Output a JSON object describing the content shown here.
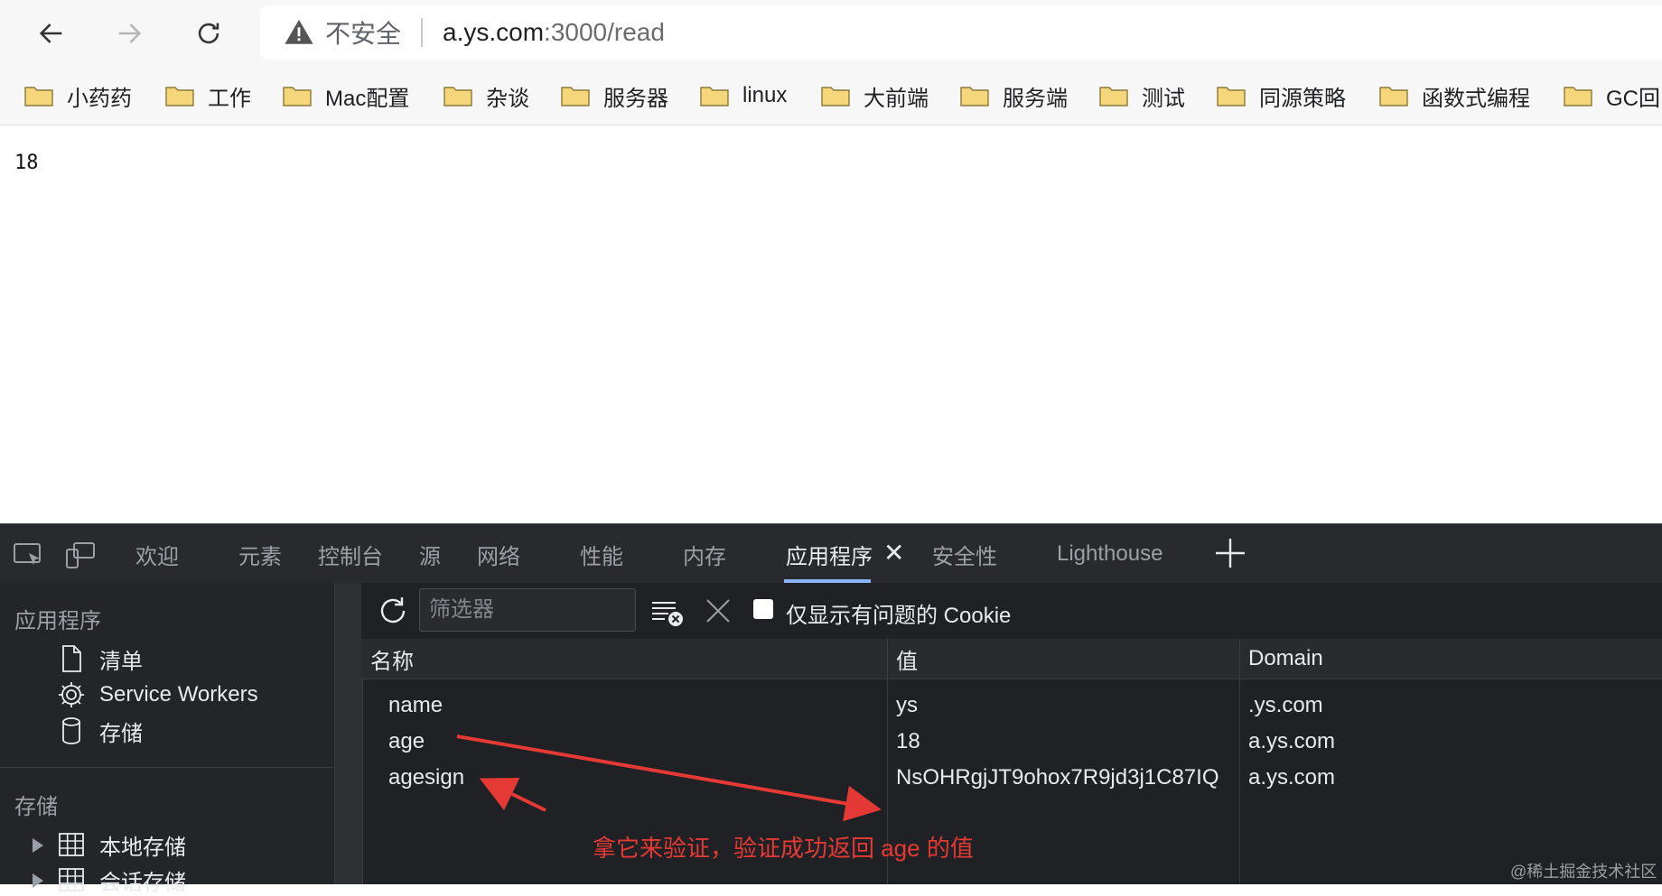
{
  "browser": {
    "security_label": "不安全",
    "url_host": "a.ys.com",
    "url_rest": ":3000/read"
  },
  "bookmarks": [
    "小药药",
    "工作",
    "Mac配置",
    "杂谈",
    "服务器",
    "linux",
    "大前端",
    "服务端",
    "测试",
    "同源策略",
    "函数式编程",
    "GC回"
  ],
  "page": {
    "content": "18"
  },
  "devtools": {
    "tabs": [
      "欢迎",
      "元素",
      "控制台",
      "源",
      "网络",
      "性能",
      "内存",
      "应用程序",
      "安全性",
      "Lighthouse"
    ],
    "active_tab": "应用程序",
    "sidebar": {
      "section_app": "应用程序",
      "app_items": [
        "清单",
        "Service Workers",
        "存储"
      ],
      "section_storage": "存储",
      "storage_items": [
        "本地存储",
        "会话存储"
      ]
    },
    "toolbar": {
      "filter_placeholder": "筛选器",
      "only_issues_label": "仅显示有问题的 Cookie"
    },
    "cookies": {
      "columns": [
        "名称",
        "值",
        "Domain"
      ],
      "rows": [
        {
          "name": "name",
          "value": "ys",
          "domain": ".ys.com"
        },
        {
          "name": "age",
          "value": "18",
          "domain": "a.ys.com"
        },
        {
          "name": "agesign",
          "value": "NsOHRgjJT9ohox7R9jd3j1C87IQ",
          "domain": "a.ys.com"
        }
      ]
    }
  },
  "annotation": "拿它来验证，验证成功返回 age 的值",
  "watermark": "@稀土掘金技术社区",
  "colors": {
    "annotation": "#e53935",
    "devtools_bg": "#202124",
    "accent": "#8ab4f8"
  }
}
